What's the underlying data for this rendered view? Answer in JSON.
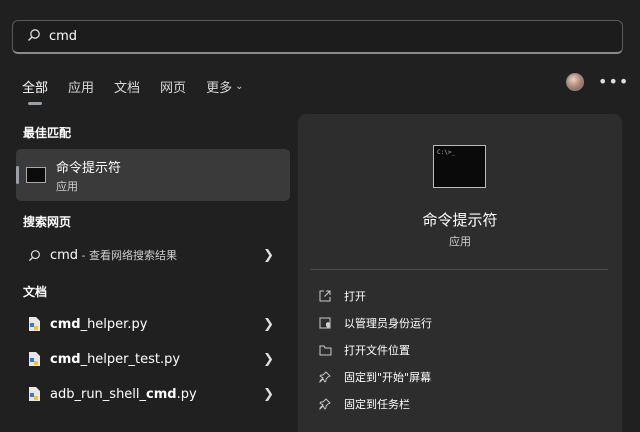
{
  "search": {
    "query": "cmd"
  },
  "tabs": [
    {
      "label": "全部",
      "active": true
    },
    {
      "label": "应用"
    },
    {
      "label": "文档"
    },
    {
      "label": "网页"
    },
    {
      "label": "更多"
    }
  ],
  "sections": {
    "best_match": "最佳匹配",
    "web": "搜索网页",
    "documents": "文档"
  },
  "best_match": {
    "title": "命令提示符",
    "subtitle": "应用"
  },
  "web_result": {
    "query": "cmd",
    "suffix": " - 查看网络搜索结果"
  },
  "documents": [
    {
      "bold": "cmd",
      "rest": "_helper.py"
    },
    {
      "bold": "cmd",
      "rest": "_helper_test.py"
    },
    {
      "prefix": "adb_run_shell_",
      "bold": "cmd",
      "rest": ".py"
    }
  ],
  "preview": {
    "title": "命令提示符",
    "subtitle": "应用",
    "icon_text": "C:\\>_",
    "actions": [
      {
        "label": "打开",
        "icon": "open-icon"
      },
      {
        "label": "以管理员身份运行",
        "icon": "admin-shield-icon"
      },
      {
        "label": "打开文件位置",
        "icon": "folder-icon"
      },
      {
        "label": "固定到\"开始\"屏幕",
        "icon": "pin-icon"
      },
      {
        "label": "固定到任务栏",
        "icon": "pin-icon"
      }
    ]
  },
  "colors": {
    "background": "#202020",
    "panel": "#2d2d2d",
    "selected": "#3a3a3a"
  }
}
